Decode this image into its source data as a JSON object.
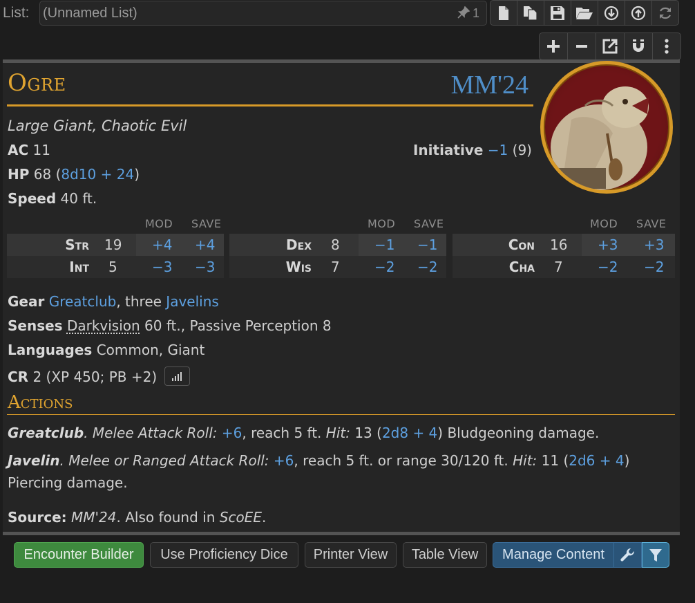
{
  "toolbar": {
    "list_label": "List:",
    "list_placeholder": "(Unnamed List)",
    "pin_count": "1",
    "file_buttons": [
      "new-file-icon",
      "copy-icon",
      "save-icon",
      "folder-open-icon",
      "download-icon",
      "upload-icon",
      "refresh-icon"
    ],
    "edit_buttons": [
      "plus-icon",
      "minus-icon",
      "external-link-icon",
      "magnet-icon",
      "more-vertical-icon"
    ]
  },
  "creature": {
    "name": "Ogre",
    "source_short": "MM'24",
    "type_line": "Large Giant, Chaotic Evil",
    "ac_label": "AC",
    "ac_value": "11",
    "hp_label": "HP",
    "hp_value": "68",
    "hp_formula": "8d10 + 24",
    "speed_label": "Speed",
    "speed_value": "40 ft.",
    "initiative_label": "Initiative",
    "initiative_mod": "−1",
    "initiative_score": "(9)"
  },
  "abilities": {
    "mod_header": "MOD",
    "save_header": "SAVE",
    "groups": [
      [
        {
          "name": "Str",
          "score": "19",
          "mod": "+4",
          "save": "+4"
        },
        {
          "name": "Int",
          "score": "5",
          "mod": "−3",
          "save": "−3"
        }
      ],
      [
        {
          "name": "Dex",
          "score": "8",
          "mod": "−1",
          "save": "−1"
        },
        {
          "name": "Wis",
          "score": "7",
          "mod": "−2",
          "save": "−2"
        }
      ],
      [
        {
          "name": "Con",
          "score": "16",
          "mod": "+3",
          "save": "+3"
        },
        {
          "name": "Cha",
          "score": "7",
          "mod": "−2",
          "save": "−2"
        }
      ]
    ]
  },
  "details": {
    "gear_label": "Gear",
    "gear_item1": "Greatclub",
    "gear_sep": ", three ",
    "gear_item2": "Javelins",
    "senses_label": "Senses",
    "senses_link": "Darkvision",
    "senses_rest": " 60 ft., Passive Perception 8",
    "languages_label": "Languages",
    "languages_value": "Common, Giant",
    "cr_label": "CR",
    "cr_value": "2 (XP 450; PB +2)"
  },
  "actions": {
    "title": "Actions",
    "list": [
      {
        "name": "Greatclub",
        "type": "Melee Attack Roll:",
        "bonus": "+6",
        "reach": ", reach 5 ft. ",
        "hit_label": "Hit:",
        "hit_avg": " 13 (",
        "hit_dice": "2d8 + 4",
        "hit_rest": ") Bludgeoning damage."
      },
      {
        "name": "Javelin",
        "type": "Melee or Ranged Attack Roll:",
        "bonus": "+6",
        "reach": ", reach 5 ft. or range 30/120 ft. ",
        "hit_label": "Hit:",
        "hit_avg": " 11 (",
        "hit_dice": "2d6 + 4",
        "hit_rest": ") Piercing damage."
      }
    ]
  },
  "source": {
    "label": "Source:",
    "primary": "MM'24",
    "mid": ". Also found in ",
    "secondary": "ScoEE",
    "end": "."
  },
  "buttons": {
    "encounter_builder": "Encounter Builder",
    "proficiency_dice": "Use Proficiency Dice",
    "printer_view": "Printer View",
    "table_view": "Table View",
    "manage_content": "Manage Content"
  },
  "colors": {
    "accent_gold": "#e0a430",
    "link_blue": "#5da0e0",
    "green_button": "#3e8a3e",
    "blue_button": "#2a5478"
  }
}
